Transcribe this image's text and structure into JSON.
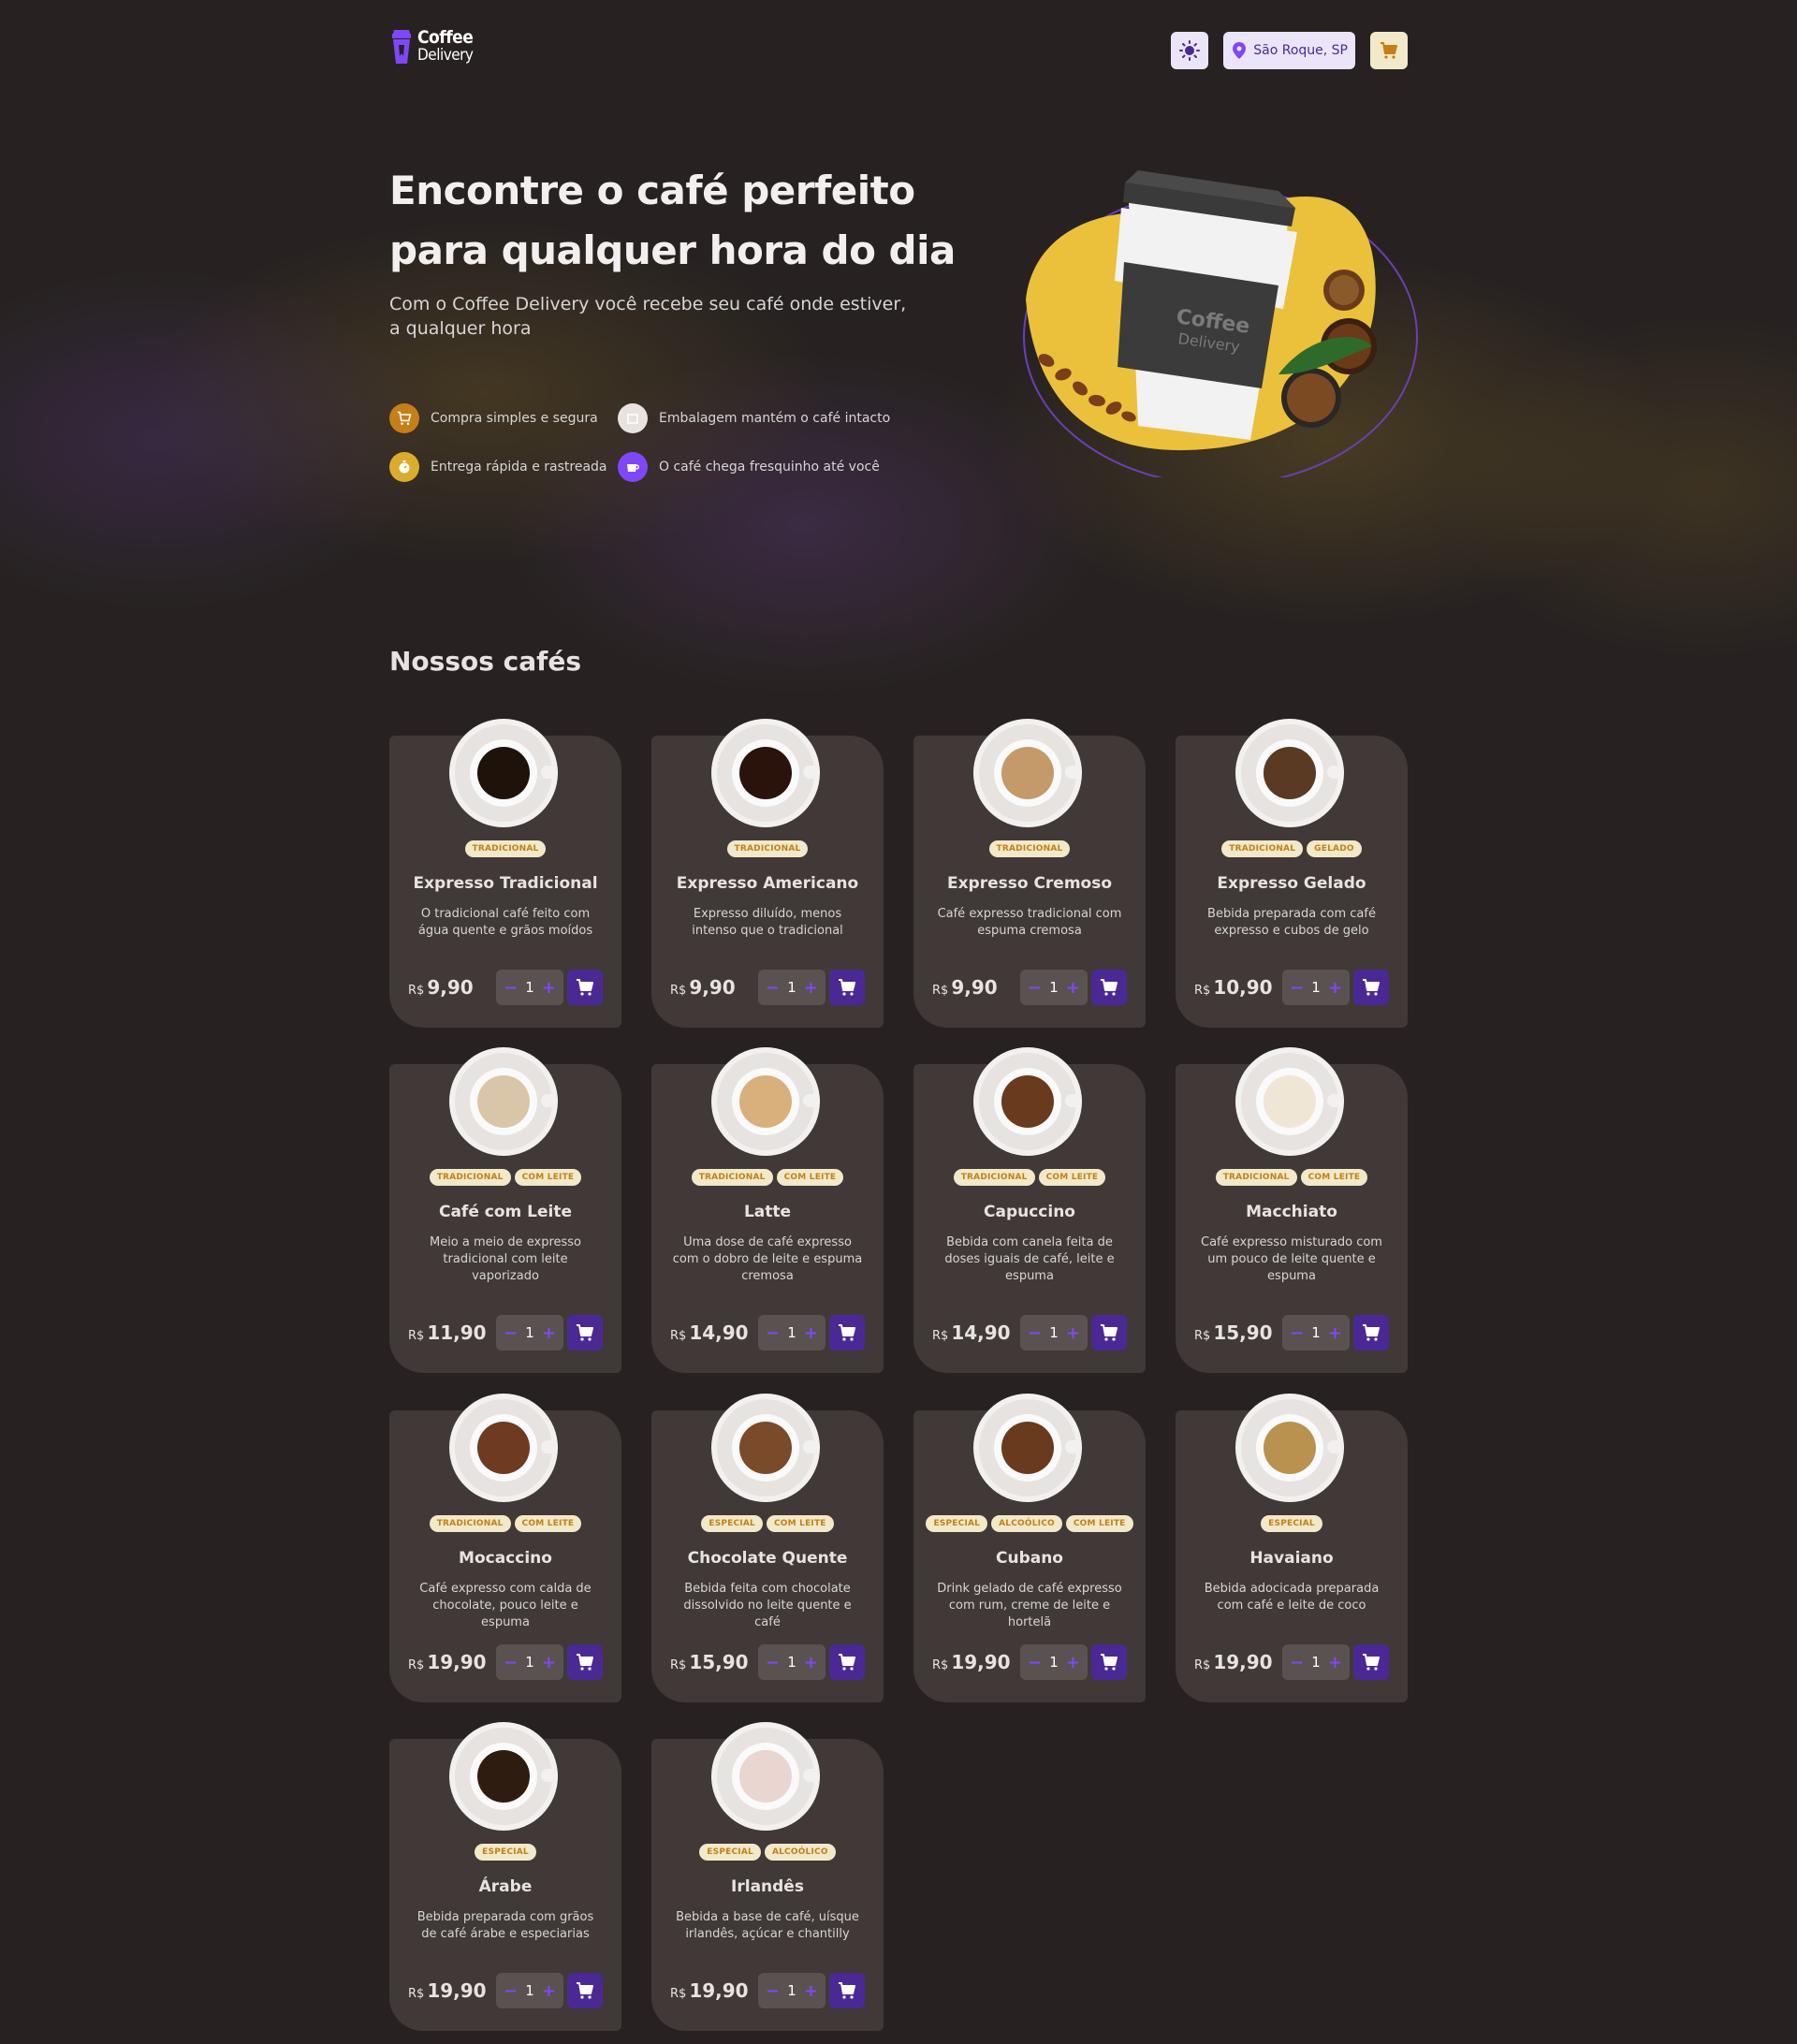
{
  "header": {
    "logo_line1": "Coffee",
    "logo_line2": "Delivery",
    "location": "São Roque, SP"
  },
  "hero": {
    "title_line1": "Encontre o café perfeito",
    "title_line2": "para qualquer hora do dia",
    "subtitle": "Com o Coffee Delivery você recebe seu café onde estiver, a qualquer hora",
    "features": [
      {
        "label": "Compra simples e segura",
        "icon": "cart-icon",
        "color": "#c47f17"
      },
      {
        "label": "Embalagem mantém o café intacto",
        "icon": "package-icon",
        "color": "#e8e3e1"
      },
      {
        "label": "Entrega rápida e rastreada",
        "icon": "timer-icon",
        "color": "#dbac2c"
      },
      {
        "label": "O café chega fresquinho até você",
        "icon": "coffee-icon",
        "color": "#8047f8"
      }
    ],
    "cup_brand_line1": "Coffee",
    "cup_brand_line2": "Delivery"
  },
  "section_title": "Nossos cafés",
  "currency": "R$",
  "coffees": [
    {
      "name": "Expresso Tradicional",
      "tags": [
        "TRADICIONAL"
      ],
      "description": "O tradicional café feito com água quente e grãos moídos",
      "price": "9,90",
      "qty": "1"
    },
    {
      "name": "Expresso Americano",
      "tags": [
        "TRADICIONAL"
      ],
      "description": "Expresso diluído, menos intenso que o tradicional",
      "price": "9,90",
      "qty": "1"
    },
    {
      "name": "Expresso Cremoso",
      "tags": [
        "TRADICIONAL"
      ],
      "description": "Café expresso tradicional com espuma cremosa",
      "price": "9,90",
      "qty": "1"
    },
    {
      "name": "Expresso Gelado",
      "tags": [
        "TRADICIONAL",
        "GELADO"
      ],
      "description": "Bebida preparada com café expresso e cubos de gelo",
      "price": "10,90",
      "qty": "1"
    },
    {
      "name": "Café com Leite",
      "tags": [
        "TRADICIONAL",
        "COM LEITE"
      ],
      "description": "Meio a meio de expresso tradicional com leite vaporizado",
      "price": "11,90",
      "qty": "1"
    },
    {
      "name": "Latte",
      "tags": [
        "TRADICIONAL",
        "COM LEITE"
      ],
      "description": "Uma dose de café expresso com o dobro de leite e espuma cremosa",
      "price": "14,90",
      "qty": "1"
    },
    {
      "name": "Capuccino",
      "tags": [
        "TRADICIONAL",
        "COM LEITE"
      ],
      "description": "Bebida com canela feita de doses iguais de café, leite e espuma",
      "price": "14,90",
      "qty": "1"
    },
    {
      "name": "Macchiato",
      "tags": [
        "TRADICIONAL",
        "COM LEITE"
      ],
      "description": "Café expresso misturado com um pouco de leite quente e espuma",
      "price": "15,90",
      "qty": "1"
    },
    {
      "name": "Mocaccino",
      "tags": [
        "TRADICIONAL",
        "COM LEITE"
      ],
      "description": "Café expresso com calda de chocolate, pouco leite e espuma",
      "price": "19,90",
      "qty": "1"
    },
    {
      "name": "Chocolate Quente",
      "tags": [
        "ESPECIAL",
        "COM LEITE"
      ],
      "description": "Bebida feita com chocolate dissolvido no leite quente e café",
      "price": "15,90",
      "qty": "1"
    },
    {
      "name": "Cubano",
      "tags": [
        "ESPECIAL",
        "ALCOÓLICO",
        "COM LEITE"
      ],
      "description": "Drink gelado de café expresso com rum, creme de leite e hortelã",
      "price": "19,90",
      "qty": "1"
    },
    {
      "name": "Havaiano",
      "tags": [
        "ESPECIAL"
      ],
      "description": "Bebida adocicada preparada com café e leite de coco",
      "price": "19,90",
      "qty": "1"
    },
    {
      "name": "Árabe",
      "tags": [
        "ESPECIAL"
      ],
      "description": "Bebida preparada com grãos de café árabe e especiarias",
      "price": "19,90",
      "qty": "1"
    },
    {
      "name": "Irlandês",
      "tags": [
        "ESPECIAL",
        "ALCOÓLICO"
      ],
      "description": "Bebida a base de café, uísque irlandês, açúcar e chantilly",
      "price": "19,90",
      "qty": "1"
    }
  ],
  "colors": {
    "purple": "#8047f8",
    "purple_dark": "#4b2995",
    "yellow": "#dbac2c",
    "yellow_dark": "#c47f17",
    "card_bg": "#403937",
    "page_bg": "#272221"
  }
}
